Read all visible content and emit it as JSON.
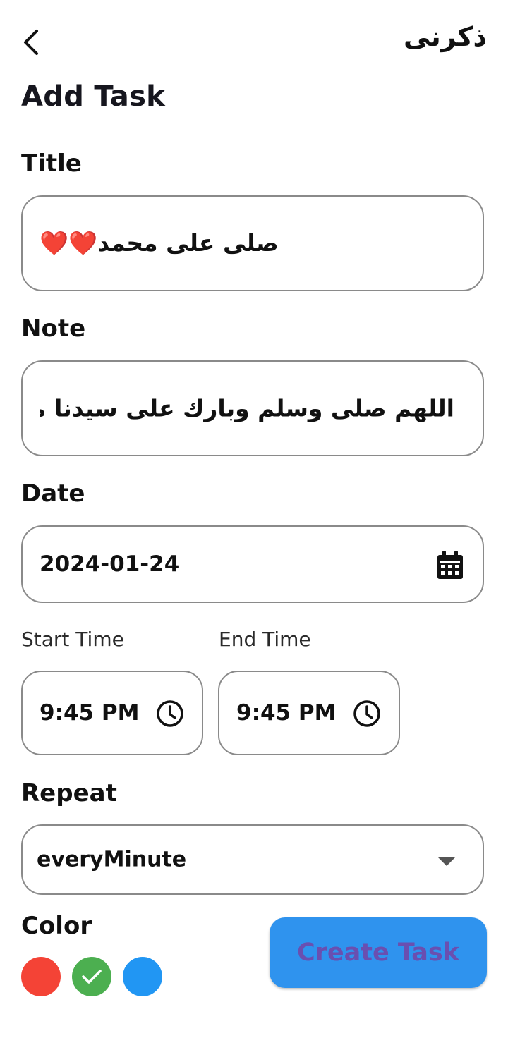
{
  "header": {
    "app_title": "ذكرنى",
    "back_icon": "chevron-left-icon"
  },
  "page": {
    "title": "Add Task"
  },
  "form": {
    "title_label": "Title",
    "title_value": "صلى على محمد❤️❤️",
    "note_label": "Note",
    "note_value": "اللهم صلى وسلم وبارك على سيدنا محمد",
    "date_label": "Date",
    "date_value": "2024-01-24",
    "date_icon": "calendar-icon",
    "start_time_label": "Start Time",
    "start_time_value": "9:45 PM",
    "end_time_label": "End Time",
    "end_time_value": "9:45 PM",
    "time_icon": "clock-icon",
    "repeat_label": "Repeat",
    "repeat_value": "everyMinute",
    "repeat_icon": "dropdown-arrow-icon",
    "color_label": "Color"
  },
  "colors": {
    "options": [
      {
        "name": "red",
        "hex": "#f44336",
        "selected": false
      },
      {
        "name": "green",
        "hex": "#4caf50",
        "selected": true
      },
      {
        "name": "blue",
        "hex": "#2196f3",
        "selected": false
      }
    ],
    "button_bg": "#2f93ee",
    "button_text": "#6a4fb0"
  },
  "actions": {
    "create_label": "Create Task"
  }
}
